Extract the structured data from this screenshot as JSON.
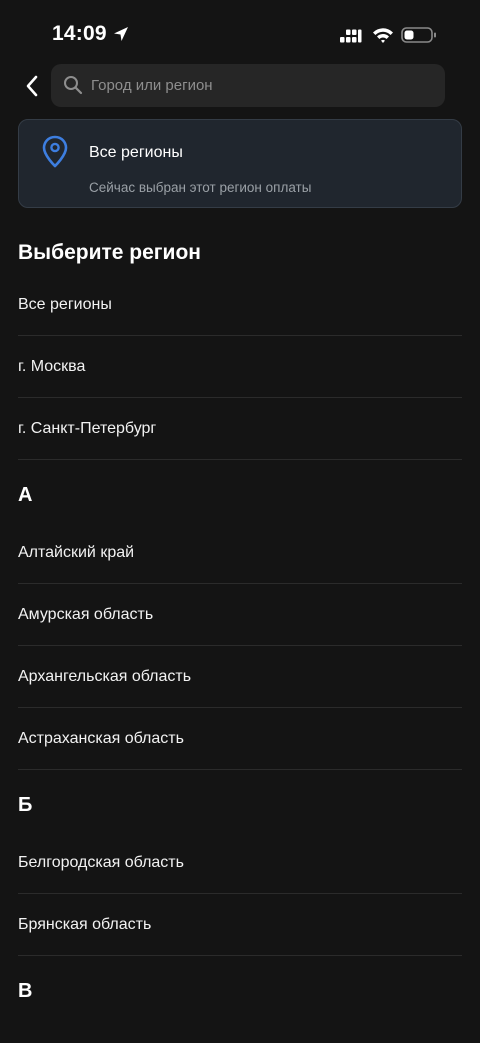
{
  "status_bar": {
    "time": "14:09"
  },
  "search": {
    "placeholder": "Город или регион",
    "value": ""
  },
  "current_region": {
    "title": "Все регионы",
    "subtitle": "Сейчас выбран этот регион оплаты",
    "accent_color": "#3d7ee0"
  },
  "section_title": "Выберите регион",
  "top_items": [
    {
      "label": "Все регионы"
    },
    {
      "label": "г. Москва"
    },
    {
      "label": "г. Санкт-Петербург"
    }
  ],
  "groups": [
    {
      "letter": "А",
      "items": [
        {
          "label": "Алтайский край"
        },
        {
          "label": "Амурская область"
        },
        {
          "label": "Архангельская область"
        },
        {
          "label": "Астраханская область"
        }
      ]
    },
    {
      "letter": "Б",
      "items": [
        {
          "label": "Белгородская область"
        },
        {
          "label": "Брянская область"
        }
      ]
    },
    {
      "letter": "В",
      "items": []
    }
  ]
}
